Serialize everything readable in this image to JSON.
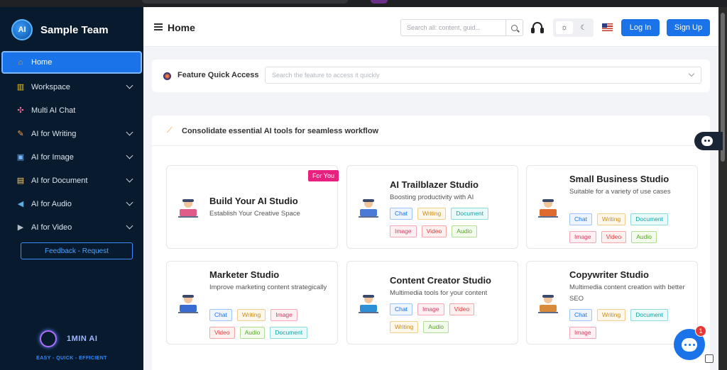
{
  "brand": {
    "name": "Sample Team",
    "logo_text": "AI"
  },
  "nav": [
    {
      "label": "Home",
      "icon": "house-icon",
      "glyph": "⌂",
      "color": "#f39c12",
      "active": true,
      "chevron": false
    },
    {
      "label": "Workspace",
      "icon": "chart-icon",
      "glyph": "▥",
      "color": "#f1c40f",
      "chevron": true
    },
    {
      "label": "Multi AI Chat",
      "icon": "network-icon",
      "glyph": "✣",
      "color": "#ff6b9a",
      "chevron": false
    },
    {
      "label": "AI for Writing",
      "icon": "pen-icon",
      "glyph": "✎",
      "color": "#ff9f43",
      "chevron": true
    },
    {
      "label": "AI for Image",
      "icon": "image-icon",
      "glyph": "▣",
      "color": "#74b9ff",
      "chevron": true
    },
    {
      "label": "AI for Document",
      "icon": "books-icon",
      "glyph": "▤",
      "color": "#fdcb6e",
      "chevron": true
    },
    {
      "label": "AI for Audio",
      "icon": "speaker-icon",
      "glyph": "◀",
      "color": "#5dade2",
      "chevron": true
    },
    {
      "label": "AI for Video",
      "icon": "video-icon",
      "glyph": "▶",
      "color": "#b2bec3",
      "chevron": true
    }
  ],
  "feedback_label": "Feedback - Request",
  "footer": {
    "label": "1MIN AI",
    "tagline": "EASY - QUICK - EFFICIENT"
  },
  "header": {
    "title": "Home",
    "search_placeholder": "Search all: content, guid...",
    "login_label": "Log In",
    "signup_label": "Sign Up",
    "theme_sun": "☼",
    "theme_moon": "☾"
  },
  "feature_access": {
    "label": "Feature Quick Access",
    "placeholder": "Search the feature to access it quickly"
  },
  "tools": {
    "title": "Consolidate essential AI tools for seamless workflow",
    "cards": [
      {
        "title": "Build Your AI Studio",
        "desc": "Establish Your Creative Space",
        "badge": "For You",
        "tags": [],
        "icon": "studio-desk-icon"
      },
      {
        "title": "AI Trailblazer Studio",
        "desc": "Boosting productivity with AI",
        "tags": [
          "Chat",
          "Writing",
          "Document",
          "Image",
          "Video",
          "Audio"
        ],
        "icon": "engineer-icon"
      },
      {
        "title": "Small Business Studio",
        "desc": "Suitable for a variety of use cases",
        "tags": [
          "Chat",
          "Writing",
          "Document",
          "Image",
          "Video",
          "Audio"
        ],
        "icon": "shop-icon"
      },
      {
        "title": "Marketer Studio",
        "desc": "Improve marketing content strategically",
        "tags": [
          "Chat",
          "Writing",
          "Image",
          "Video",
          "Audio",
          "Document"
        ],
        "icon": "marketer-icon"
      },
      {
        "title": "Content Creator Studio",
        "desc": "Multimedia tools for your content",
        "tags": [
          "Chat",
          "Image",
          "Video",
          "Writing",
          "Audio"
        ],
        "icon": "creator-icon"
      },
      {
        "title": "Copywriter Studio",
        "desc": "Multimedia content creation with better SEO",
        "tags": [
          "Chat",
          "Writing",
          "Document",
          "Image"
        ],
        "icon": "copywriter-icon"
      }
    ]
  },
  "chat_badge": "1"
}
